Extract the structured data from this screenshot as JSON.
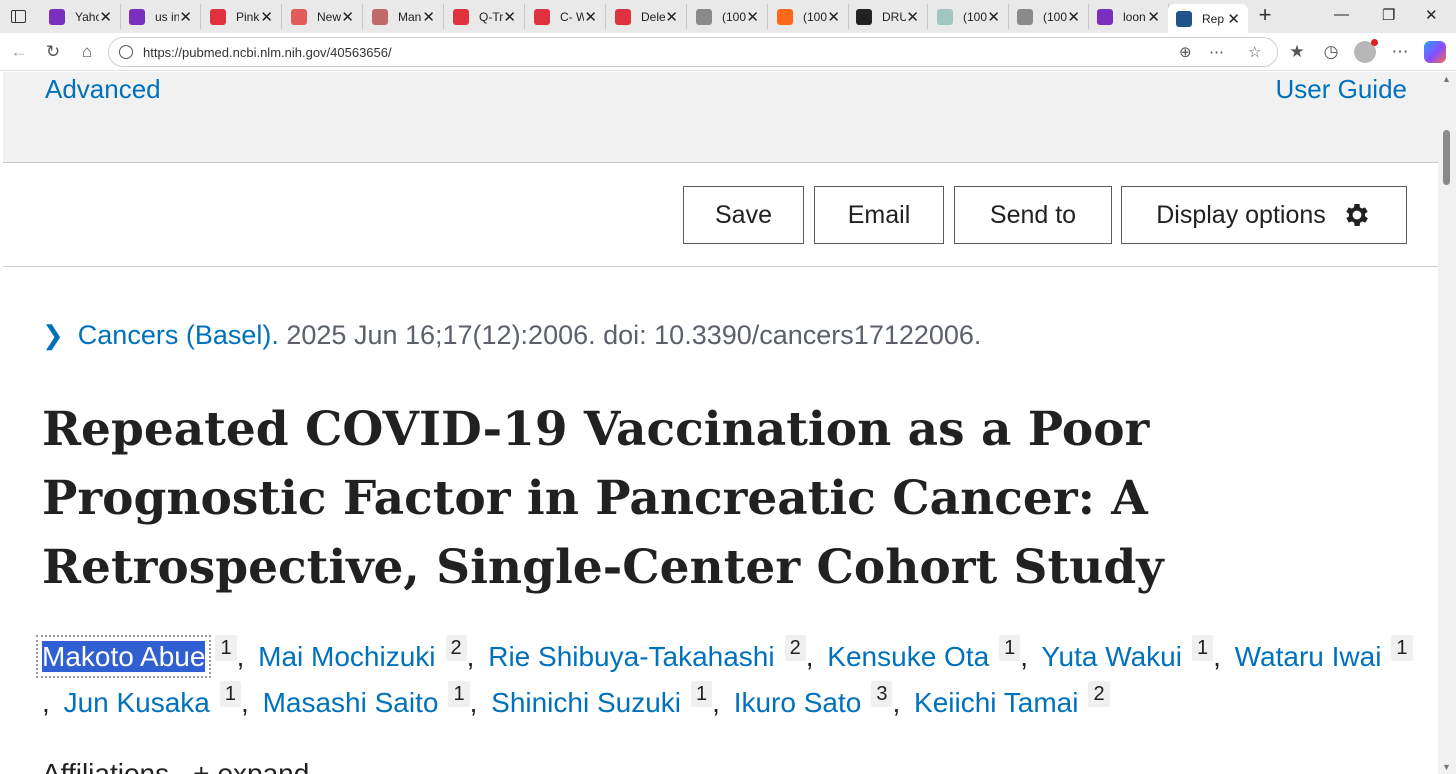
{
  "browser": {
    "tabs": [
      {
        "title": "Yaho",
        "icon": "yahoo-icon",
        "color": "#7b2fbe"
      },
      {
        "title": "us in",
        "icon": "yahoo-icon",
        "color": "#7b2fbe"
      },
      {
        "title": "Pink",
        "icon": "youtube-icon",
        "color": "#e0323e"
      },
      {
        "title": "New",
        "icon": "news-icon",
        "color": "#e25c5c"
      },
      {
        "title": "Man",
        "icon": "image-icon",
        "color": "#c06b6b"
      },
      {
        "title": "Q-Tr",
        "icon": "youtube-icon",
        "color": "#e0323e"
      },
      {
        "title": "C- W",
        "icon": "youtube-icon",
        "color": "#e0323e"
      },
      {
        "title": "Dele",
        "icon": "youtube-icon",
        "color": "#e0323e"
      },
      {
        "title": "(100",
        "icon": "fp-icon",
        "color": "#8a8a8a"
      },
      {
        "title": "(100",
        "icon": "substack-icon",
        "color": "#ff6719"
      },
      {
        "title": "DRU",
        "icon": "dru-icon",
        "color": "#222222"
      },
      {
        "title": "(100",
        "icon": "pattern-icon",
        "color": "#9fc7c0"
      },
      {
        "title": "(100",
        "icon": "fp-icon",
        "color": "#8a8a8a"
      },
      {
        "title": "loon",
        "icon": "yahoo-icon",
        "color": "#7b2fbe"
      },
      {
        "title": "Rep",
        "icon": "pubmed-icon",
        "color": "#20558a",
        "active": true
      }
    ],
    "url": "https://pubmed.ncbi.nlm.nih.gov/40563656/"
  },
  "search_panel": {
    "advanced_label": "Advanced",
    "user_guide_label": "User Guide"
  },
  "actions": {
    "save_label": "Save",
    "email_label": "Email",
    "send_to_label": "Send to",
    "display_options_label": "Display options"
  },
  "citation": {
    "journal": "Cancers (Basel).",
    "details": " 2025 Jun 16;17(12):2006. doi: 10.3390/cancers17122006."
  },
  "article": {
    "title": "Repeated COVID-19 Vaccination as a Poor Prognostic Factor in Pancreatic Cancer: A Retrospective, Single-Center Cohort Study"
  },
  "authors": [
    {
      "name": "Makoto Abue",
      "aff": "1",
      "selected": true
    },
    {
      "name": "Mai Mochizuki",
      "aff": "2"
    },
    {
      "name": "Rie Shibuya-Takahashi",
      "aff": "2"
    },
    {
      "name": "Kensuke Ota",
      "aff": "1"
    },
    {
      "name": "Yuta Wakui",
      "aff": "1"
    },
    {
      "name": "Wataru Iwai",
      "aff": "1"
    },
    {
      "name": "Jun Kusaka",
      "aff": "1"
    },
    {
      "name": "Masashi Saito",
      "aff": "1"
    },
    {
      "name": "Shinichi Suzuki",
      "aff": "1"
    },
    {
      "name": "Ikuro Sato",
      "aff": "3"
    },
    {
      "name": "Keiichi Tamai",
      "aff": "2"
    }
  ],
  "affiliations": {
    "label": "Affiliations",
    "toggle_symbol": "+",
    "toggle_label": "expand"
  },
  "colors": {
    "link": "#0071bc",
    "selection": "#2f5fd0",
    "text": "#212121"
  }
}
